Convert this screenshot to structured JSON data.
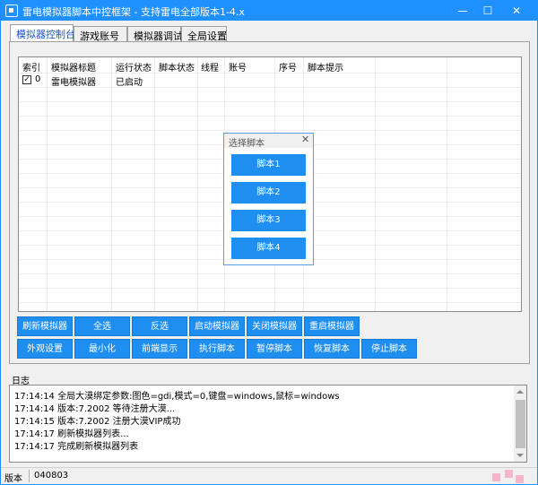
{
  "window": {
    "title": "雷电模拟器脚本中控框架 - 支持雷电全部版本1-4.x",
    "controls": {
      "minimize": "—",
      "maximize": "☐",
      "close": "✕"
    }
  },
  "tabs": [
    "模拟器控制台",
    "游戏账号",
    "模拟器调试",
    "全局设置"
  ],
  "grid": {
    "columns": [
      "索引",
      "模拟器标题",
      "运行状态",
      "脚本状态",
      "线程",
      "账号",
      "序号",
      "脚本提示"
    ],
    "rows": [
      {
        "checked": "✓",
        "index": "0",
        "title": "雷电模拟器",
        "run_status": "已启动",
        "script_status": "",
        "thread": "",
        "account": "",
        "serial": "",
        "hint": ""
      }
    ]
  },
  "buttons_row1": [
    "刷新模拟器",
    "全选",
    "反选",
    "启动模拟器",
    "关闭模拟器",
    "重启模拟器"
  ],
  "buttons_row2": [
    "外观设置",
    "最小化",
    "前端显示",
    "执行脚本",
    "暂停脚本",
    "恢复脚本",
    "停止脚本"
  ],
  "dialog": {
    "title": "选择脚本",
    "close": "✕",
    "options": [
      "脚本1",
      "脚本2",
      "脚本3",
      "脚本4"
    ]
  },
  "log": {
    "label": "日志",
    "lines": [
      "17:14:14  全局大漠绑定参数:图色=gdi,模式=0,键盘=windows,鼠标=windows",
      "17:14:14  版本:7.2002 等待注册大漠...",
      "17:14:15  版本:7.2002 注册大漠VIP成功",
      "17:14:17  刷新模拟器列表...",
      "17:14:17  完成刷新模拟器列表"
    ]
  },
  "status": {
    "label": "版本",
    "value": "040803"
  }
}
